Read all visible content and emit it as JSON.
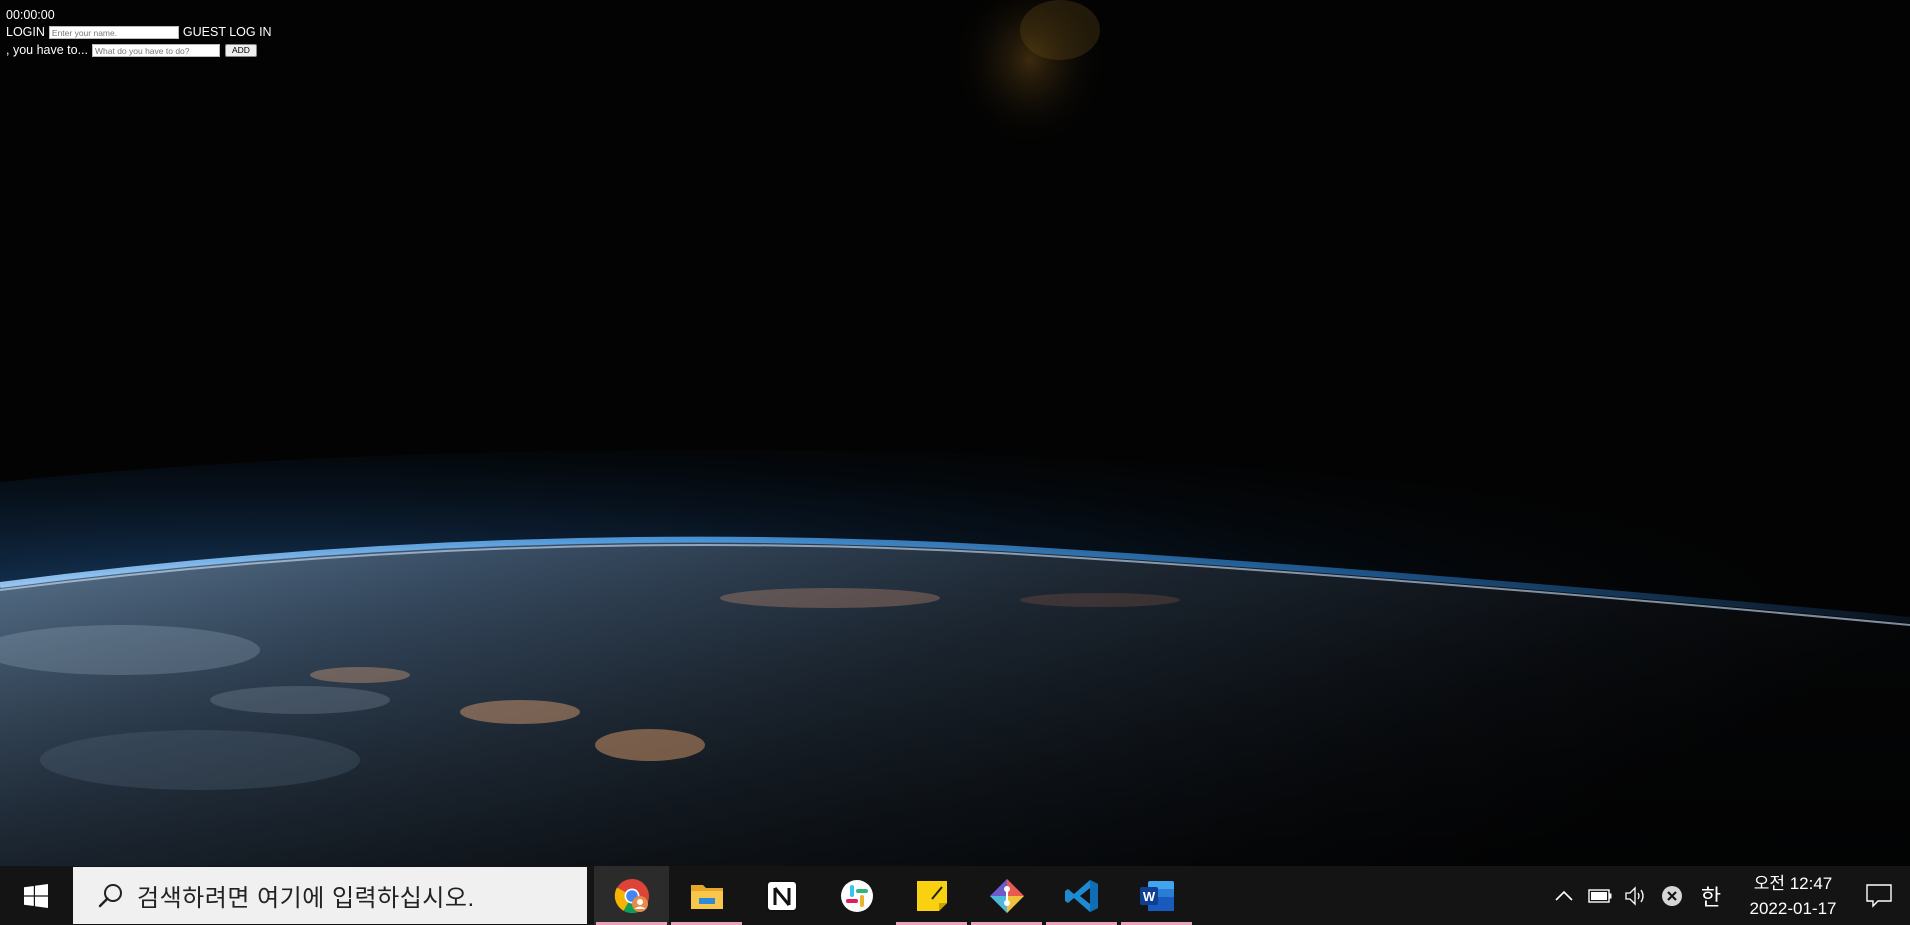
{
  "app": {
    "timer": "00:00:00",
    "login_label": "LOGIN",
    "name_placeholder": "Enter your name.",
    "guest_login_label": "GUEST LOG IN",
    "todo_prefix": ", you have to...",
    "todo_placeholder": "What do you have to do?",
    "add_button_label": "ADD"
  },
  "taskbar": {
    "search_placeholder": "검색하려면 여기에 입력하십시오.",
    "pinned_apps": [
      {
        "name": "chrome-icon",
        "running": true,
        "active": true
      },
      {
        "name": "file-explorer-icon",
        "running": true
      },
      {
        "name": "notion-icon",
        "running": false
      },
      {
        "name": "slack-icon",
        "running": false
      },
      {
        "name": "sticky-notes-icon",
        "running": true
      },
      {
        "name": "git-kraken-icon",
        "running": true
      },
      {
        "name": "vscode-icon",
        "running": true
      },
      {
        "name": "word-icon",
        "running": true
      }
    ],
    "tray": {
      "ime_indicator": "한",
      "clock_time": "오전 12:47",
      "clock_date": "2022-01-17"
    }
  },
  "colors": {
    "taskbar_bg": "#141414",
    "running_indicator": "#e9a3b8",
    "space_bg": "#030303"
  }
}
